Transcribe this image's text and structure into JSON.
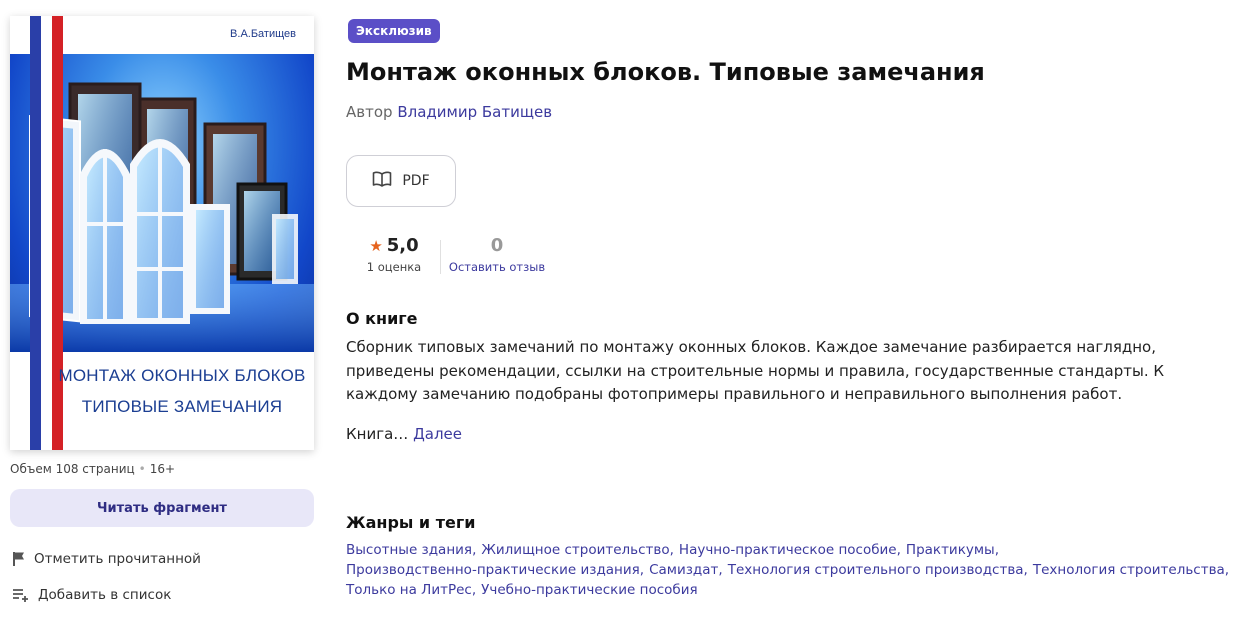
{
  "cover": {
    "author": "В.А.Батищев",
    "title_line1": "МОНТАЖ ОКОННЫХ БЛОКОВ",
    "title_line2": "ТИПОВЫЕ ЗАМЕЧАНИЯ",
    "colors": {
      "blue": "#2a3fa8",
      "red": "#d42126",
      "title": "#1b3e92"
    }
  },
  "meta": {
    "pages": "Объем 108 страниц",
    "separator": "•",
    "age": "16+"
  },
  "read_fragment_label": "Читать фрагмент",
  "actions": {
    "mark_read": {
      "label": "Отметить прочитанной",
      "icon": "flag-icon"
    },
    "add_list": {
      "label": "Добавить в список",
      "icon": "playlist-add-icon"
    }
  },
  "badge": "Эксклюзив",
  "title": "Монтаж оконных блоков. Типовые замечания",
  "author": {
    "prefix": "Автор",
    "name": "Владимир Батищев"
  },
  "format": {
    "label": "PDF",
    "icon": "open-book-icon"
  },
  "rating": {
    "value": "5,0",
    "count_label": "1 оценка",
    "icon": "star-icon"
  },
  "reviews": {
    "count": "0",
    "link": "Оставить отзыв"
  },
  "about": {
    "title": "О книге",
    "text": "Сборник типовых замечаний по монтажу оконных блоков. Каждое замечание разбирается наглядно, приведены рекомендации, ссылки на строительные нормы и правила, государственные стандарты. К каждому замечанию подобраны фотопримеры правильного и неправильного выполнения работ.",
    "more_prefix": "Книга…",
    "more_link": "Далее"
  },
  "tags": {
    "title": "Жанры и теги",
    "items": [
      "Высотные здания",
      "Жилищное строительство",
      "Научно-практическое пособие",
      "Практикумы",
      "Производственно-практические издания",
      "Самиздат",
      "Технология строительного производства",
      "Технология строительства",
      "Только на ЛитРес",
      "Учебно-практические пособия"
    ]
  },
  "colors": {
    "accent": "#3c3a9e",
    "badge": "#5b4fc7",
    "button_bg": "#e8e7f8",
    "star": "#e6631d"
  }
}
